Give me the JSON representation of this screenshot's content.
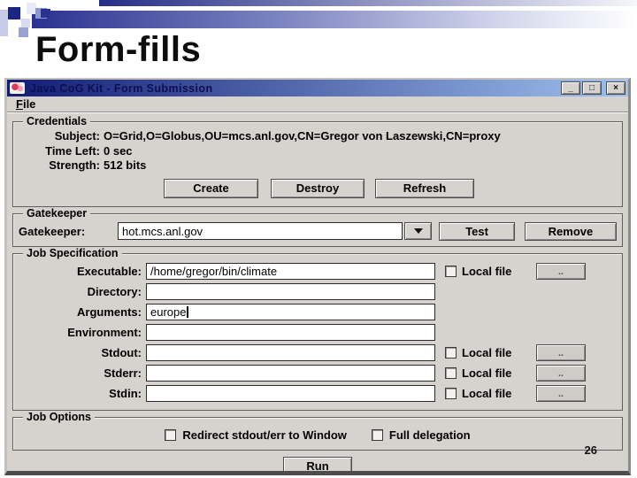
{
  "slide": {
    "title": "Form-fills",
    "page_number": "26"
  },
  "window": {
    "title": "Java CoG Kit - Form Submission",
    "menu": {
      "file": "File"
    },
    "controls": {
      "minimize": "_",
      "maximize": "□",
      "close": "×"
    }
  },
  "credentials": {
    "group_label": "Credentials",
    "subject_label": "Subject:",
    "subject_value": "O=Grid,O=Globus,OU=mcs.anl.gov,CN=Gregor von Laszewski,CN=proxy",
    "time_left_label": "Time Left:",
    "time_left_value": "0 sec",
    "strength_label": "Strength:",
    "strength_value": "512 bits",
    "buttons": [
      "Create",
      "Destroy",
      "Refresh"
    ]
  },
  "gatekeeper": {
    "group_label": "Gatekeeper",
    "field_label": "Gatekeeper:",
    "field_value": "hot.mcs.anl.gov",
    "test_label": "Test",
    "remove_label": "Remove"
  },
  "job_specification": {
    "group_label": "Job Specification",
    "local_file_label": "Local file",
    "browse_label": "..",
    "rows": [
      {
        "label": "Executable:",
        "value": "/home/gregor/bin/climate"
      },
      {
        "label": "Directory:",
        "value": ""
      },
      {
        "label": "Arguments:",
        "value": "europe"
      },
      {
        "label": "Environment:",
        "value": ""
      },
      {
        "label": "Stdout:",
        "value": ""
      },
      {
        "label": "Stderr:",
        "value": ""
      },
      {
        "label": "Stdin:",
        "value": ""
      }
    ]
  },
  "job_options": {
    "group_label": "Job Options",
    "checkboxes": [
      "Redirect stdout/err to Window",
      "Full delegation"
    ],
    "run_label": "Run"
  },
  "colors": {
    "accent_navy": "#2b3290",
    "titlebar_left": "#121c74",
    "titlebar_right": "#9ec1ee",
    "window_gray": "#d6d3ce"
  }
}
